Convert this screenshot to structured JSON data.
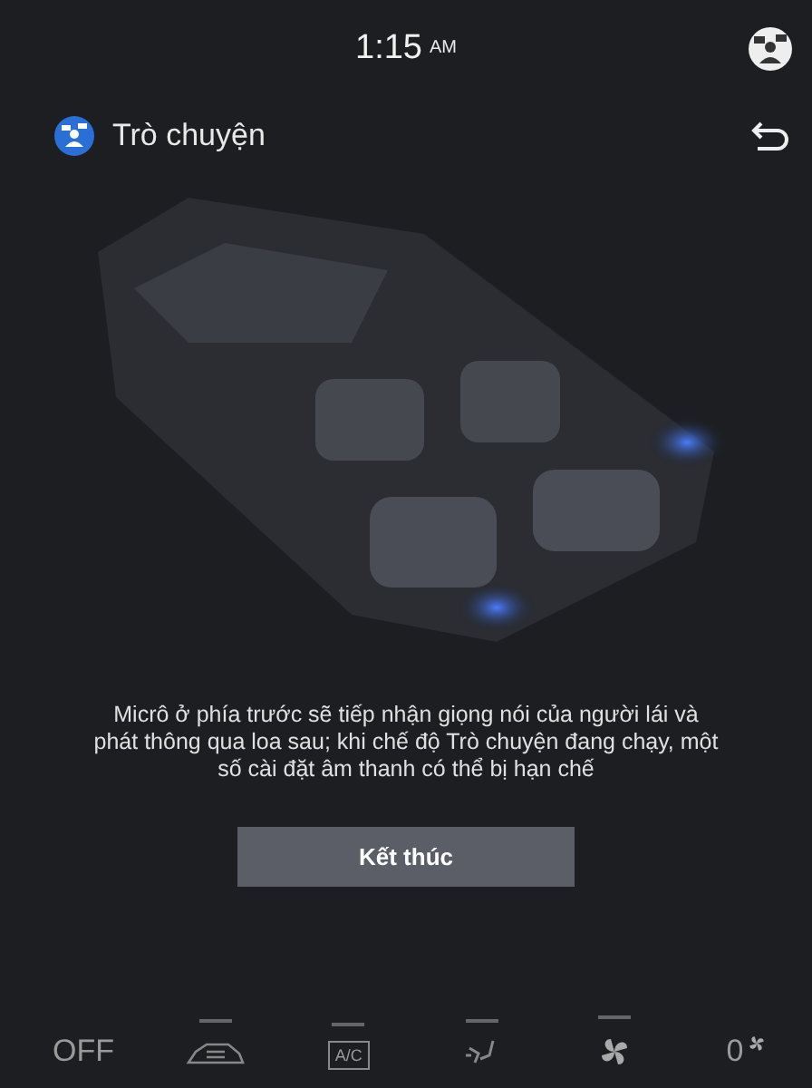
{
  "status_bar": {
    "time": "1:15",
    "meridiem": "AM"
  },
  "header": {
    "title": "Trò chuyện"
  },
  "description": "Micrô ở phía trước sẽ tiếp nhận giọng nói của người lái và phát thông qua loa sau; khi chế độ Trò chuyện đang chạy, một số cài đặt âm thanh có thể bị hạn chế",
  "end_button": {
    "label": "Kết thúc"
  },
  "climate_bar": [
    {
      "kind": "power",
      "label": "OFF"
    },
    {
      "kind": "recirculation",
      "on": false
    },
    {
      "kind": "ac",
      "label": "A/C",
      "on": false
    },
    {
      "kind": "defrost",
      "on": false
    },
    {
      "kind": "fan",
      "on": false
    },
    {
      "kind": "fan_speed",
      "label": "0"
    }
  ]
}
